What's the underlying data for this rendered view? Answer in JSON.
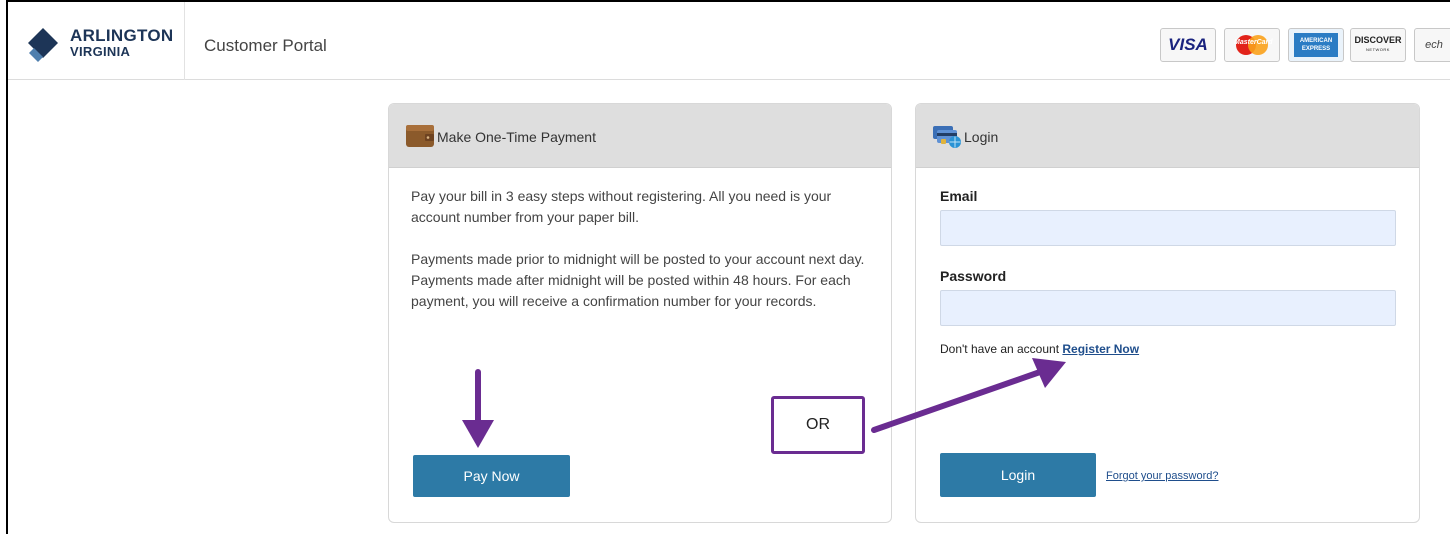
{
  "header": {
    "logo_line1": "ARLINGTON",
    "logo_line2": "VIRGINIA",
    "portal_title": "Customer Portal",
    "cards": {
      "visa": "VISA",
      "mastercard": "MasterCard",
      "amex_line1": "AMERICAN",
      "amex_line2": "EXPRESS",
      "discover": "DISCOVER",
      "discover_sub": "NETWORK",
      "echeck": "ech"
    }
  },
  "payment_panel": {
    "title": "Make One-Time Payment",
    "icon": "wallet-icon",
    "paragraph1": "Pay your bill in 3 easy steps without registering. All you need is your account number from your paper bill.",
    "paragraph2": "Payments made prior to midnight will be posted to your account next day. Payments made after midnight will be posted within 48 hours. For each payment, you will receive a confirmation number for your records.",
    "button_label": "Pay Now"
  },
  "login_panel": {
    "title": "Login",
    "icon": "credit-cards-globe-icon",
    "email_label": "Email",
    "email_value": "",
    "password_label": "Password",
    "password_value": "",
    "register_prompt": "Don't have an account",
    "register_link": "Register Now",
    "login_button": "Login",
    "forgot_link": "Forgot your password?"
  },
  "annotation": {
    "or_label": "OR",
    "arrow_color": "#6a2c91"
  },
  "colors": {
    "primary_button": "#2d7aa6",
    "panel_header": "#dedede",
    "input_bg": "#e8f0fe",
    "link": "#1f4e8c"
  }
}
